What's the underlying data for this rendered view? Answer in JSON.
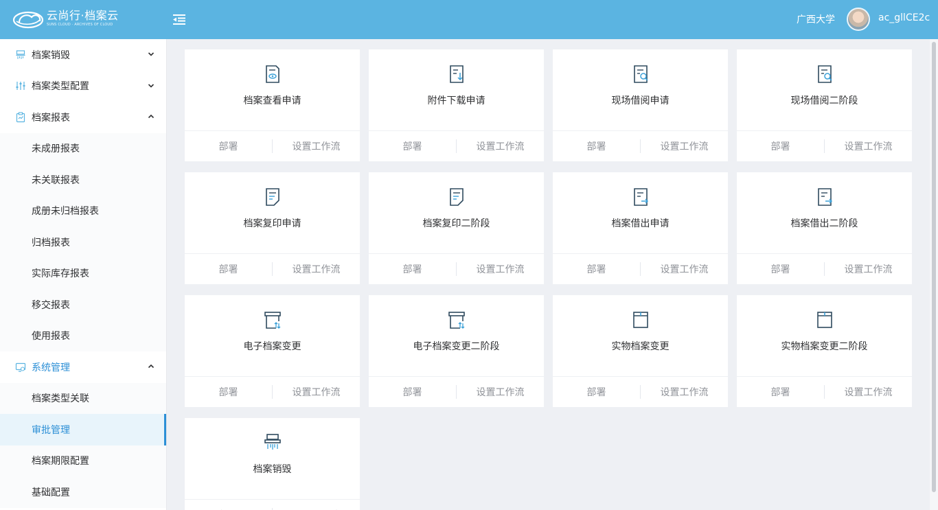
{
  "header": {
    "logo_title": "云尚行·档案云",
    "logo_subtitle": "SUNS CLOUD · ARCHIVES OF CLOUD",
    "org": "广西大学",
    "user": "ac_gllCE2c"
  },
  "sidebar": {
    "groups": [
      {
        "label": "档案销毁",
        "icon": "shredder-icon",
        "expanded": false
      },
      {
        "label": "档案类型配置",
        "icon": "sliders-icon",
        "expanded": false
      },
      {
        "label": "档案报表",
        "icon": "report-clipboard-icon",
        "expanded": true,
        "children": [
          "未成册报表",
          "未关联报表",
          "成册未归档报表",
          "归档报表",
          "实际库存报表",
          "移交报表",
          "使用报表"
        ]
      },
      {
        "label": "系统管理",
        "icon": "monitor-settings-icon",
        "expanded": true,
        "children": [
          "档案类型关联",
          "审批管理",
          "档案期限配置",
          "基础配置"
        ]
      }
    ],
    "selected": "审批管理"
  },
  "card_actions": {
    "deploy": "部署",
    "workflow": "设置工作流"
  },
  "cards": [
    {
      "title": "档案查看申请",
      "icon": "document-view-icon"
    },
    {
      "title": "附件下载申请",
      "icon": "document-download-icon"
    },
    {
      "title": "现场借阅申请",
      "icon": "document-search-icon"
    },
    {
      "title": "现场借阅二阶段",
      "icon": "document-search-icon"
    },
    {
      "title": "档案复印申请",
      "icon": "document-copy-icon"
    },
    {
      "title": "档案复印二阶段",
      "icon": "document-copy-icon"
    },
    {
      "title": "档案借出申请",
      "icon": "document-export-icon"
    },
    {
      "title": "档案借出二阶段",
      "icon": "document-export-icon"
    },
    {
      "title": "电子档案变更",
      "icon": "archive-box-swap-icon"
    },
    {
      "title": "电子档案变更二阶段",
      "icon": "archive-box-swap-icon"
    },
    {
      "title": "实物档案变更",
      "icon": "box-icon"
    },
    {
      "title": "实物档案变更二阶段",
      "icon": "box-icon"
    },
    {
      "title": "档案销毁",
      "icon": "shredder-icon"
    }
  ],
  "colors": {
    "header": "#5bb4e1",
    "accent": "#2c8fd6",
    "background": "#eef0f4"
  }
}
